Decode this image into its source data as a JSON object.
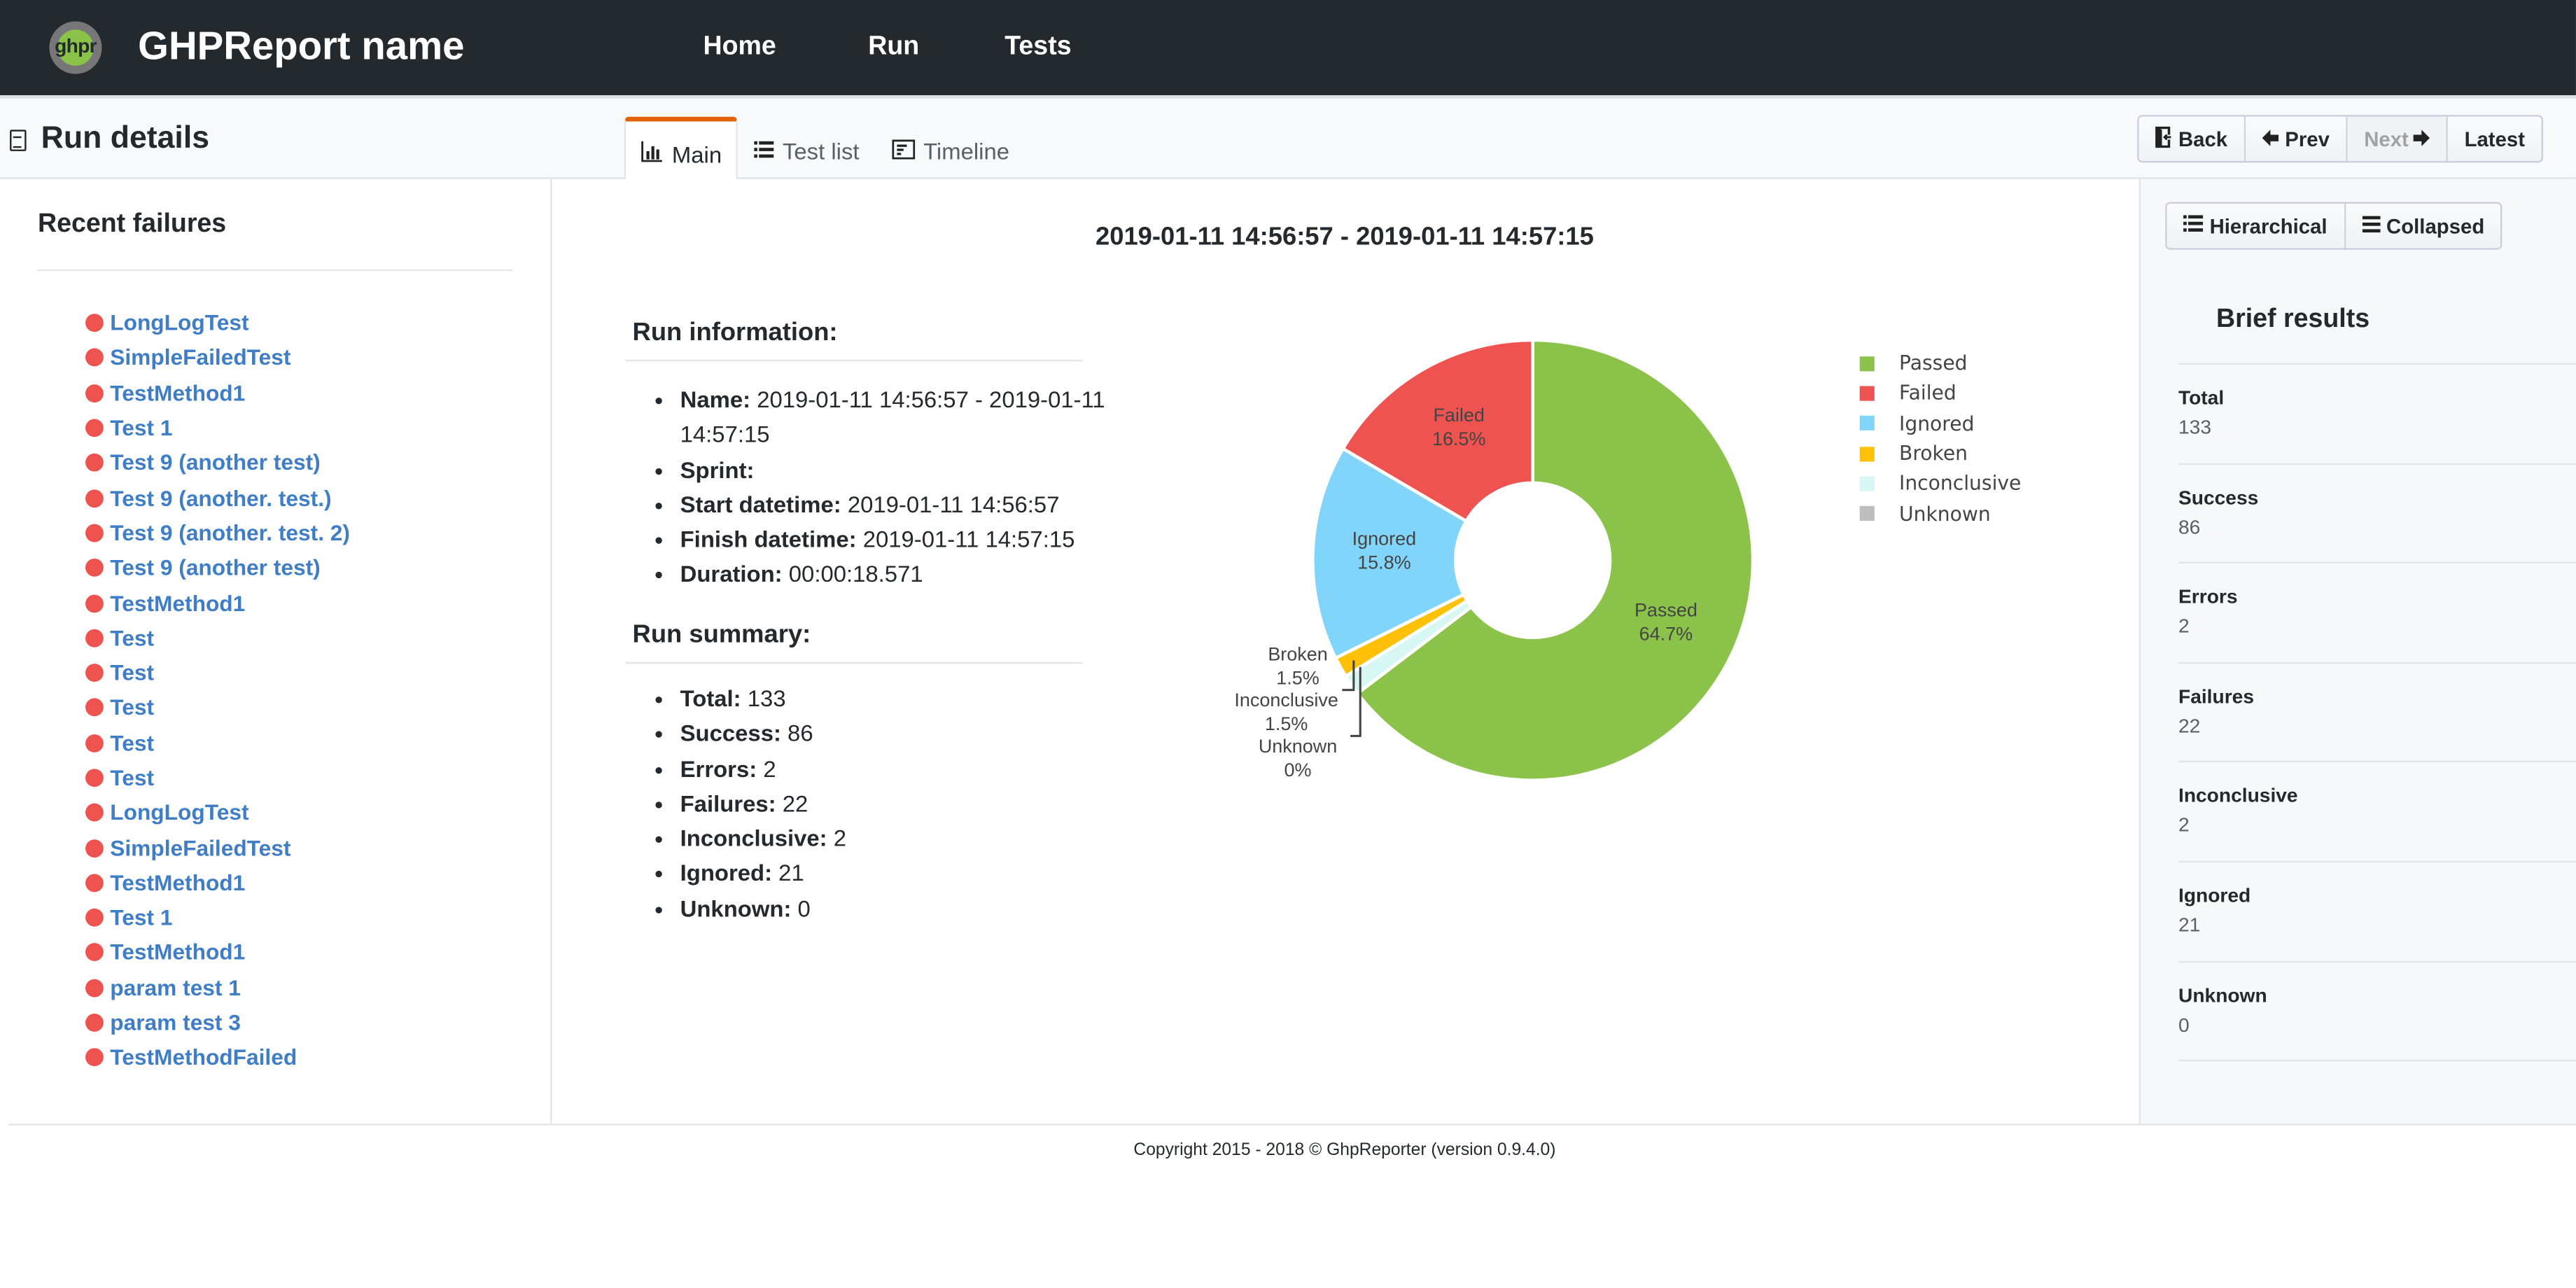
{
  "navbar": {
    "logo_text": "ghpr",
    "brand": "GHPReport name",
    "links": [
      "Home",
      "Run",
      "Tests"
    ]
  },
  "subheader": {
    "title": "Run details",
    "tabs": [
      {
        "label": "Main",
        "icon": "bar-chart-icon",
        "active": true
      },
      {
        "label": "Test list",
        "icon": "list-icon",
        "active": false
      },
      {
        "label": "Timeline",
        "icon": "timeline-icon",
        "active": false
      }
    ],
    "nav_buttons": [
      {
        "label": "Back",
        "icon": "sign-out-icon",
        "disabled": false
      },
      {
        "label": "Prev",
        "icon": "arrow-left-icon",
        "disabled": false
      },
      {
        "label": "Next",
        "icon": "arrow-right-icon",
        "disabled": true
      },
      {
        "label": "Latest",
        "icon": "",
        "disabled": false
      }
    ]
  },
  "sidebar": {
    "title": "Recent failures",
    "failures": [
      "LongLogTest",
      "SimpleFailedTest",
      "TestMethod1",
      "Test 1",
      "Test 9 (another test)",
      "Test 9 (another. test.)",
      "Test 9 (another. test. 2)",
      "Test 9 (another test)",
      "TestMethod1",
      "Test",
      "Test",
      "Test",
      "Test",
      "Test",
      "LongLogTest",
      "SimpleFailedTest",
      "TestMethod1",
      "Test 1",
      "TestMethod1",
      "param test 1",
      "param test 3",
      "TestMethodFailed"
    ]
  },
  "main": {
    "run_title": "2019-01-11 14:56:57 - 2019-01-11 14:57:15",
    "run_information": {
      "heading": "Run information:",
      "items": [
        {
          "label": "Name:",
          "value": "2019-01-11 14:56:57 - 2019-01-11 14:57:15"
        },
        {
          "label": "Sprint:",
          "value": ""
        },
        {
          "label": "Start datetime:",
          "value": "2019-01-11 14:56:57"
        },
        {
          "label": "Finish datetime:",
          "value": "2019-01-11 14:57:15"
        },
        {
          "label": "Duration:",
          "value": "00:00:18.571"
        }
      ]
    },
    "run_summary": {
      "heading": "Run summary:",
      "items": [
        {
          "label": "Total:",
          "value": "133"
        },
        {
          "label": "Success:",
          "value": "86"
        },
        {
          "label": "Errors:",
          "value": "2"
        },
        {
          "label": "Failures:",
          "value": "22"
        },
        {
          "label": "Inconclusive:",
          "value": "2"
        },
        {
          "label": "Ignored:",
          "value": "21"
        },
        {
          "label": "Unknown:",
          "value": "0"
        }
      ]
    }
  },
  "right_panel": {
    "view_buttons": [
      {
        "label": "Hierarchical",
        "icon": "list-icon"
      },
      {
        "label": "Collapsed",
        "icon": "bars-icon"
      }
    ],
    "title": "Brief results",
    "items": [
      {
        "label": "Total",
        "value": "133"
      },
      {
        "label": "Success",
        "value": "86"
      },
      {
        "label": "Errors",
        "value": "2"
      },
      {
        "label": "Failures",
        "value": "22"
      },
      {
        "label": "Inconclusive",
        "value": "2"
      },
      {
        "label": "Ignored",
        "value": "21"
      },
      {
        "label": "Unknown",
        "value": "0"
      }
    ]
  },
  "footer": {
    "text": "Copyright 2015 - 2018 © GhpReporter (version 0.9.4.0)"
  },
  "chart_data": {
    "type": "pie",
    "donut": true,
    "title": "",
    "legend_position": "right",
    "start": "top-clockwise",
    "slices": [
      {
        "name": "Passed",
        "value": 86,
        "label": "64.7%",
        "color": "#8bc34a"
      },
      {
        "name": "Unknown",
        "value": 0,
        "label": "0%",
        "color": "#bdbdbd"
      },
      {
        "name": "Inconclusive",
        "value": 2,
        "label": "1.5%",
        "color": "#d7f7f5"
      },
      {
        "name": "Broken",
        "value": 2,
        "label": "1.5%",
        "color": "#ffc107"
      },
      {
        "name": "Ignored",
        "value": 21,
        "label": "15.8%",
        "color": "#81d4fa"
      },
      {
        "name": "Failed",
        "value": 22,
        "label": "16.5%",
        "color": "#ef5350"
      }
    ],
    "legend": [
      {
        "name": "Passed",
        "color": "#8bc34a"
      },
      {
        "name": "Failed",
        "color": "#ef5350"
      },
      {
        "name": "Ignored",
        "color": "#81d4fa"
      },
      {
        "name": "Broken",
        "color": "#ffc107"
      },
      {
        "name": "Inconclusive",
        "color": "#d7f7f5"
      },
      {
        "name": "Unknown",
        "color": "#bdbdbd"
      }
    ]
  }
}
